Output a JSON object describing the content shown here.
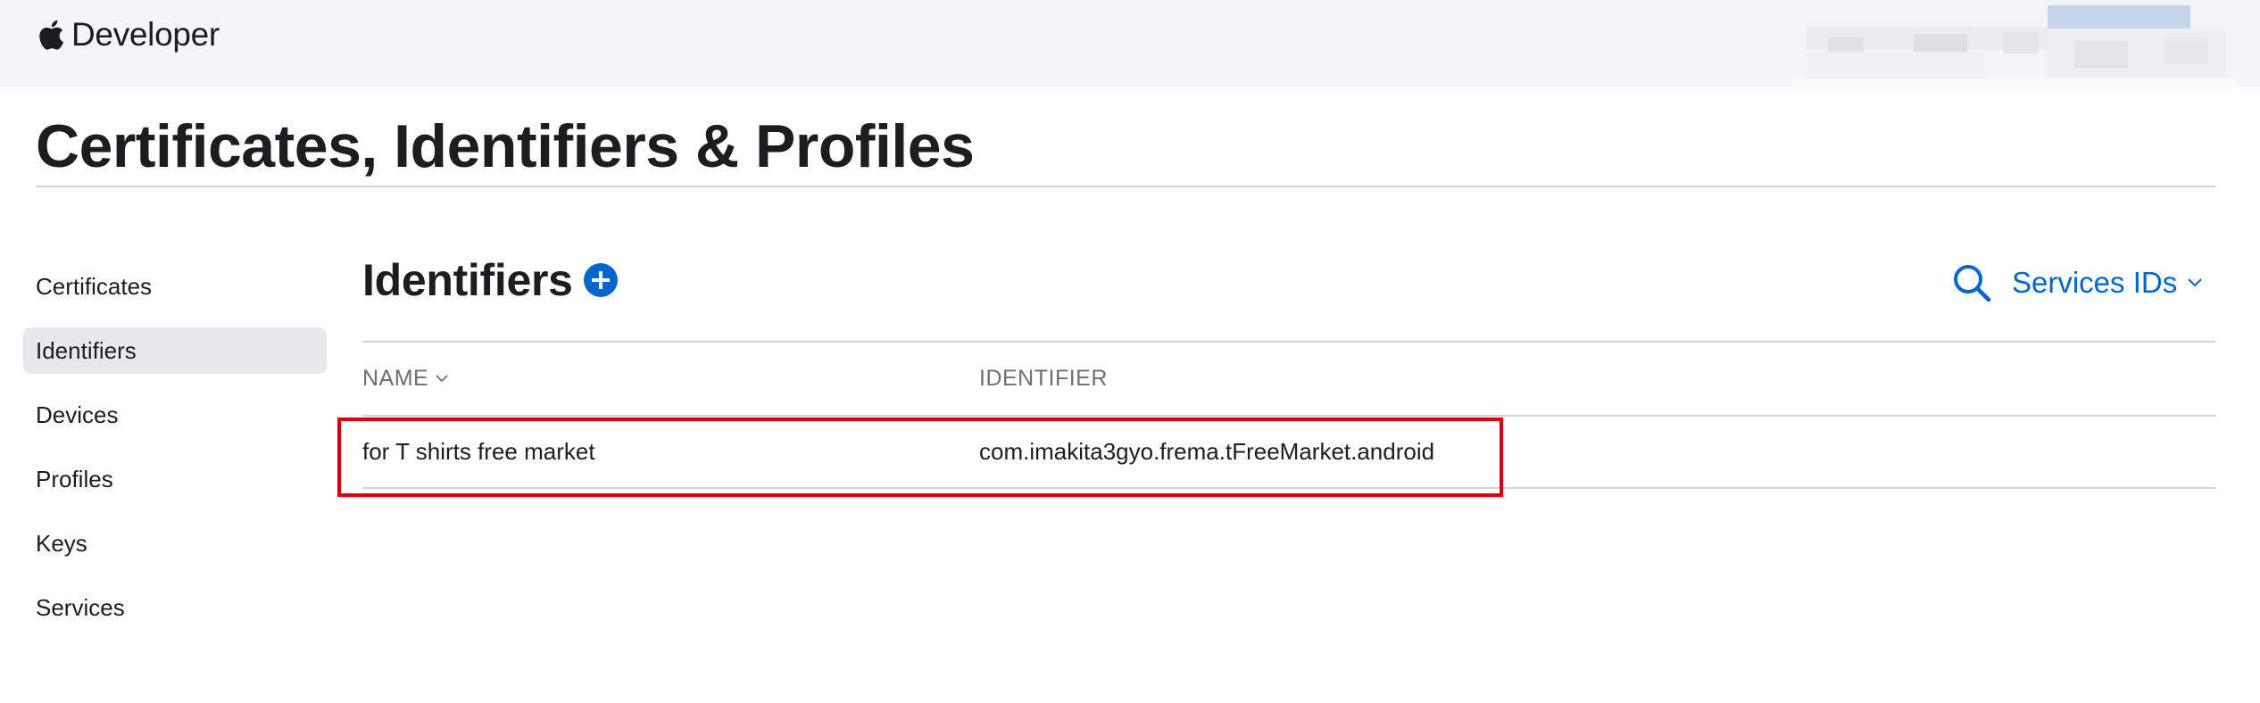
{
  "header": {
    "brand_label": "Developer",
    "account_area": "blurred"
  },
  "page": {
    "title": "Certificates, Identifiers & Profiles"
  },
  "sidebar": {
    "items": [
      {
        "label": "Certificates",
        "active": false
      },
      {
        "label": "Identifiers",
        "active": true
      },
      {
        "label": "Devices",
        "active": false
      },
      {
        "label": "Profiles",
        "active": false
      },
      {
        "label": "Keys",
        "active": false
      },
      {
        "label": "Services",
        "active": false
      }
    ]
  },
  "main": {
    "section_title": "Identifiers",
    "add_icon": "plus-circle-icon",
    "search_icon": "search-icon",
    "filter": {
      "selected": "Services IDs",
      "icon": "chevron-down-icon"
    },
    "table": {
      "columns": [
        {
          "label": "NAME",
          "sortable": true
        },
        {
          "label": "IDENTIFIER",
          "sortable": false
        }
      ],
      "rows": [
        {
          "name": "for T shirts free market",
          "identifier": "com.imakita3gyo.frema.tFreeMarket.android",
          "highlighted": true
        }
      ]
    }
  },
  "colors": {
    "accent": "#0066cc",
    "highlight": "#d70015",
    "header_bg": "#f5f5f7",
    "active_item_bg": "#e8e8ed"
  }
}
